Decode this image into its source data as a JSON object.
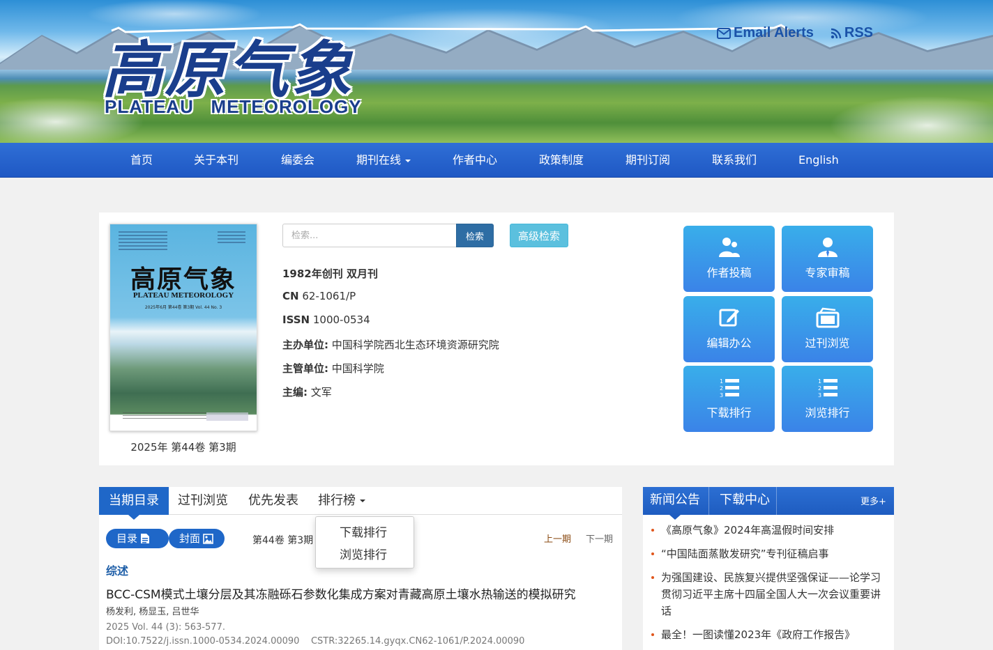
{
  "header": {
    "logo_cn": "高原气象",
    "logo_en": "PLATEAU   METEOROLOGY",
    "email_alerts": "Email Alerts",
    "rss": "RSS"
  },
  "nav": {
    "items": [
      {
        "label": "首页"
      },
      {
        "label": "关于本刊"
      },
      {
        "label": "编委会"
      },
      {
        "label": "期刊在线",
        "dropdown": true
      },
      {
        "label": "作者中心"
      },
      {
        "label": "政策制度"
      },
      {
        "label": "期刊订阅"
      },
      {
        "label": "联系我们"
      },
      {
        "label": "English"
      }
    ]
  },
  "cover": {
    "title": "高原气象",
    "title_en": "PLATEAU METEOROLOGY",
    "issue_line": "2025年6月  第44卷  第3期  Vol. 44  No. 3",
    "caption": "2025年 第44卷 第3期"
  },
  "search": {
    "placeholder": "检索...",
    "button": "检索",
    "advanced": "高级检索"
  },
  "journal_info": {
    "founded": "1982年创刊 双月刊",
    "cn_label": "CN",
    "cn_value": "62-1061/P",
    "issn_label": "ISSN",
    "issn_value": "1000-0534",
    "sponsor_label": "主办单位:",
    "sponsor_value": "中国科学院西北生态环境资源研究院",
    "supervisor_label": "主管单位:",
    "supervisor_value": "中国科学院",
    "editor_label": "主编:",
    "editor_value": "文军"
  },
  "tiles": [
    {
      "label": "作者投稿",
      "icon": "authors-icon"
    },
    {
      "label": "专家审稿",
      "icon": "expert-icon"
    },
    {
      "label": "编辑办公",
      "icon": "edit-icon"
    },
    {
      "label": "过刊浏览",
      "icon": "archive-icon"
    },
    {
      "label": "下载排行",
      "icon": "ranking-icon"
    },
    {
      "label": "浏览排行",
      "icon": "ranking-icon"
    }
  ],
  "tabs": {
    "items": [
      {
        "label": "当期目录"
      },
      {
        "label": "过刊浏览"
      },
      {
        "label": "优先发表"
      },
      {
        "label": "排行榜"
      }
    ],
    "dropdown": [
      "下载排行",
      "浏览排行"
    ]
  },
  "toc": {
    "toc_btn": "目录",
    "cover_btn": "封面",
    "volume": "第44卷 第3期",
    "prev": "上一期",
    "next": "下一期",
    "section": "综述",
    "article": {
      "title": "BCC-CSM模式土壤分层及其冻融砾石参数化集成方案对青藏高原土壤水热输送的模拟研究",
      "authors": "杨发利, 杨显玉, 吕世华",
      "citation": "2025 Vol. 44 (3): 563-577.",
      "doi": "DOI:10.7522/j.issn.1000-0534.2024.00090",
      "cstr": "CSTR:32265.14.gyqx.CN62-1061/P.2024.00090"
    }
  },
  "news": {
    "tab1": "新闻公告",
    "tab2": "下载中心",
    "more": "更多+",
    "items": [
      "《高原气象》2024年高温假时间安排",
      "“中国陆面蒸散发研究”专刊征稿启事",
      "为强国建设、民族复兴提供坚强保证——论学习贯彻习近平主席十四届全国人大一次会议重要讲话",
      "最全！一图读懂2023年《政府工作报告》"
    ]
  },
  "colors": {
    "nav_blue": "#1f58c4",
    "tab_blue": "#1f67c8",
    "tile_top": "#39aeea",
    "tile_bottom": "#3a83e8",
    "search_btn": "#2e6da4",
    "advanced_btn": "#5bc0de",
    "bullet": "#e0551b"
  }
}
